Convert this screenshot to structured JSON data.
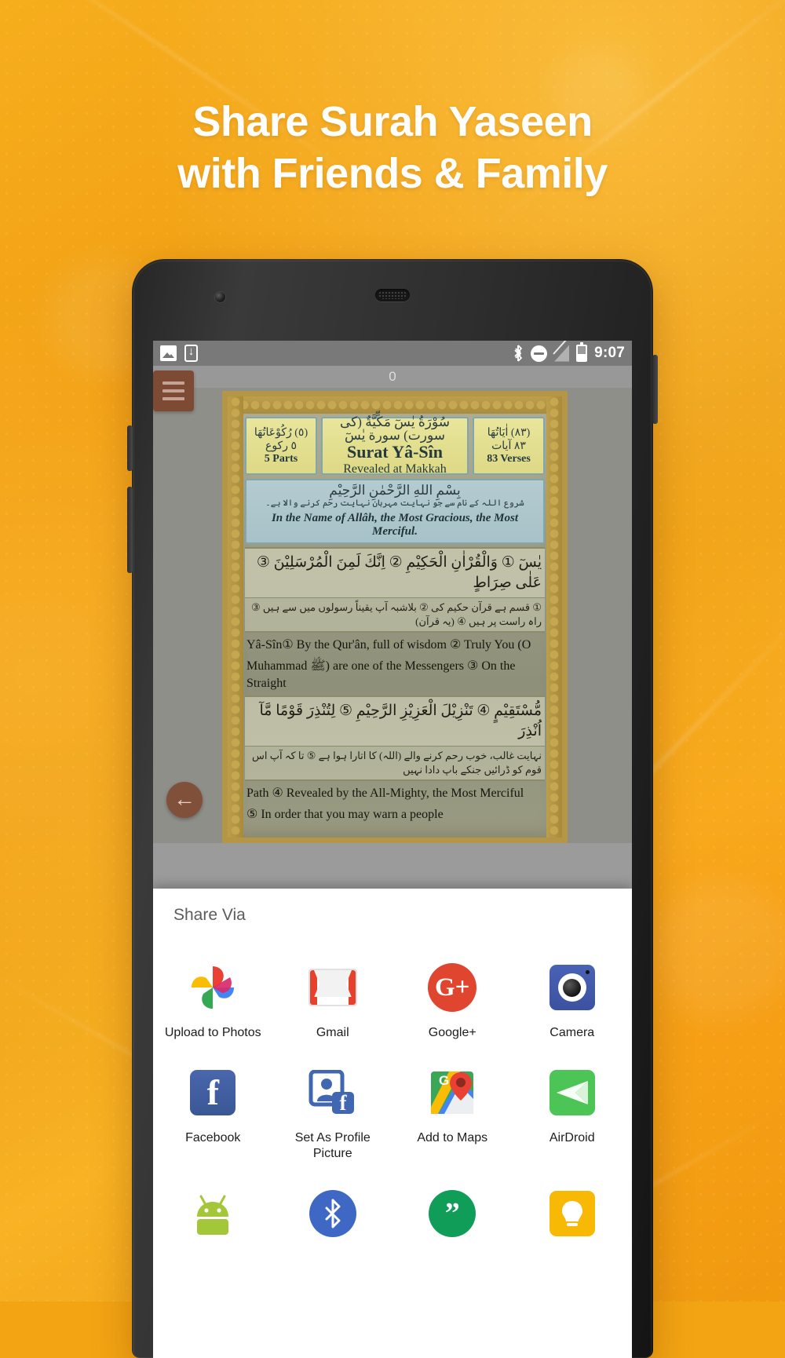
{
  "headline": {
    "line1": "Share Surah Yaseen",
    "line2": "with Friends & Family"
  },
  "phone": {
    "statusbar": {
      "icons_left": [
        "photo-icon",
        "download-icon"
      ],
      "icons_right": [
        "bluetooth-icon",
        "do-not-disturb-icon",
        "no-signal-icon",
        "battery-icon"
      ],
      "time": "9:07"
    },
    "page_number": "0",
    "nav": {
      "menu_icon": "hamburger-menu-icon",
      "back_icon": "back-arrow-icon"
    }
  },
  "quran": {
    "header": {
      "parts_arabic_top": "(٥) رُکُوْعَاتُهَا",
      "parts_arabic": "٥ رکوع",
      "parts_label": "5 Parts",
      "title_arabic": "سُوْرَةُ يٰسٓ مَكِّيَّةٌ (کی سورت) سورة يٰسٓ",
      "title_transliteration": "Surat Yâ-Sîn",
      "title_revealed": "Revealed at Makkah",
      "verses_arabic_top": "(٨٣) اٰيَاتُهَا",
      "verses_arabic": "٨٣ آيات",
      "verses_label": "83 Verses"
    },
    "bismillah": {
      "arabic": "بِسْمِ اللهِ الرَّحْمٰنِ الرَّحِيْمِ",
      "urdu": "شروع اللہ کے نام سے جو نہایت مہربان نہایت رحم کرنے والا ہے۔",
      "english": "In the Name of Allâh, the Most Gracious, the Most Merciful."
    },
    "verses": [
      {
        "arabic": "يٰسٓ ① وَالْقُرْاٰنِ الْحَكِيْمِ ② اِنَّكَ لَمِنَ الْمُرْسَلِيْنَ ③ عَلٰى صِرَاطٍ",
        "urdu": "① قسم ہے قرآن حکیم کی ② بلاشبہ آپ یقیناً رسولوں میں سے ہیں ③ راہ راست پر ہیں ④ (یہ قرآن)",
        "english_1": "Yâ-Sîn① By the Qur'ân, full of wisdom ② Truly You (O",
        "english_2": "Muhammad ﷺ) are one of the Messengers ③ On the Straight"
      },
      {
        "arabic": "مُّسْتَقِيْمٍ ④ تَنْزِيْلَ الْعَزِيْزِ الرَّحِيْمِ ⑤ لِتُنْذِرَ قَوْمًا مَّآ اُنْذِرَ",
        "urdu": "نہایت غالب، خوب رحم کرنے والے (اللہ) کا اتارا ہوا ہے ⑤ تا کہ آپ اس قوم کو ڈرائیں جنکے باپ دادا نہیں",
        "english_1": "Path ④ Revealed by the All-Mighty, the Most Merciful",
        "english_2": "⑤ In order that you may warn a people"
      }
    ]
  },
  "share_sheet": {
    "title": "Share Via",
    "apps": [
      {
        "label": "Upload to Photos",
        "icon": "google-photos-icon"
      },
      {
        "label": "Gmail",
        "icon": "gmail-icon"
      },
      {
        "label": "Google+",
        "icon": "google-plus-icon",
        "glyph": "G+"
      },
      {
        "label": "Camera",
        "icon": "camera-icon"
      },
      {
        "label": "Facebook",
        "icon": "facebook-icon",
        "glyph": "f"
      },
      {
        "label": "Set As Profile Picture",
        "icon": "set-profile-picture-icon"
      },
      {
        "label": "Add to Maps",
        "icon": "google-maps-icon"
      },
      {
        "label": "AirDroid",
        "icon": "airdroid-icon"
      },
      {
        "label": "",
        "icon": "android-beam-icon"
      },
      {
        "label": "",
        "icon": "bluetooth-share-icon"
      },
      {
        "label": "",
        "icon": "hangouts-icon",
        "glyph": "”"
      },
      {
        "label": "",
        "icon": "google-keep-icon"
      }
    ]
  },
  "colors": {
    "brand_orange": "#f3a413",
    "sheet_white": "#ffffff",
    "accent_brown": "#7d4a34"
  }
}
